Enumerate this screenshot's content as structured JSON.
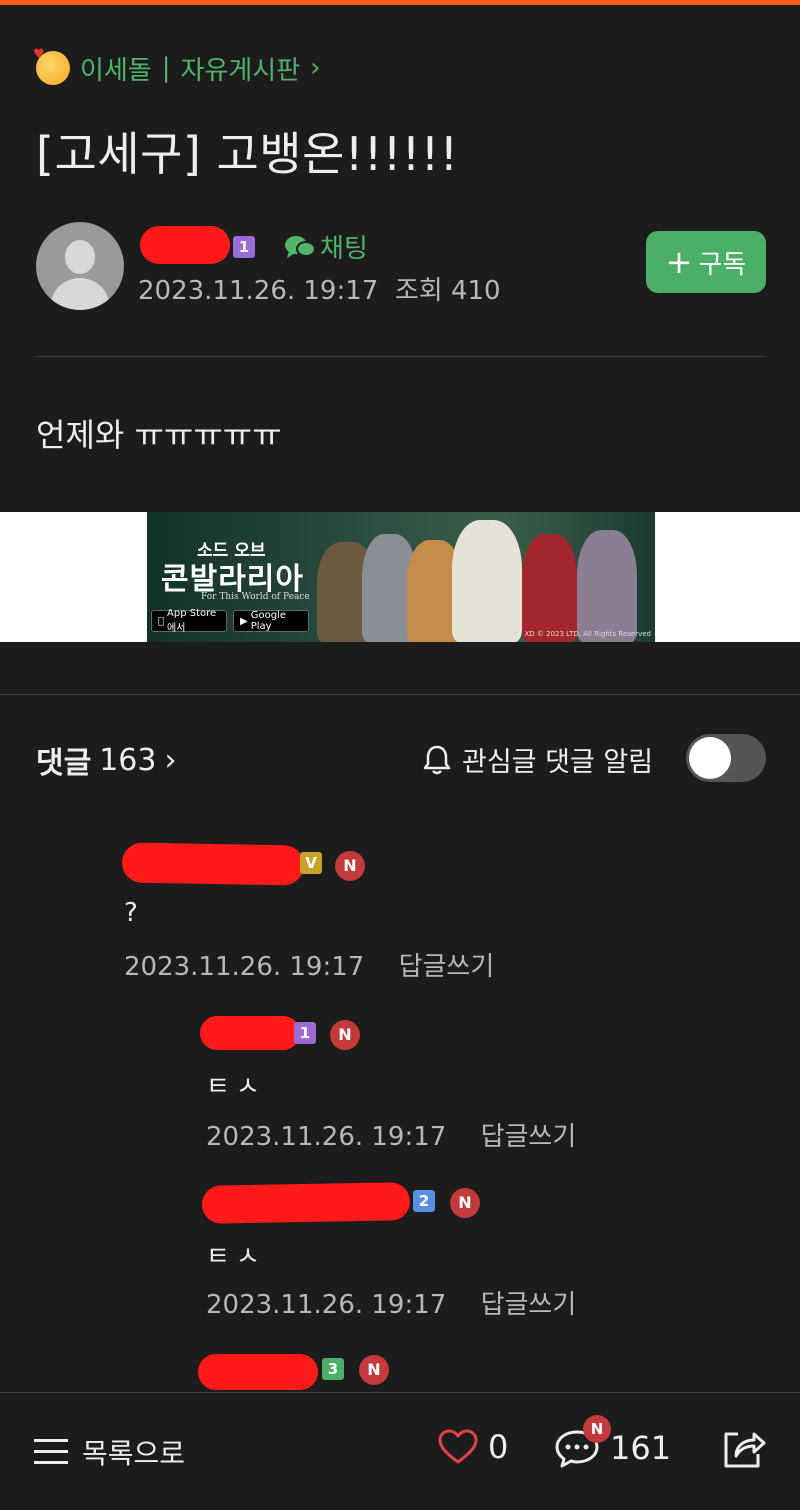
{
  "header": {
    "board_name": "이세돌",
    "board_sep": "|",
    "board_section": "자유게시판",
    "board_chevron": "›",
    "title": "[고세구] 고뱅온!!!!!!"
  },
  "author": {
    "level": "1",
    "chat_label": "채팅",
    "date": "2023.11.26. 19:17",
    "views_label": "조회",
    "views": "410",
    "subscribe_label": "구독",
    "subscribe_icon": "+"
  },
  "post": {
    "body": "언제와 ㅠㅠㅠㅠㅠ"
  },
  "ad": {
    "kicker": "소드 오브",
    "title": "콘발라리아",
    "tagline": "For This World of Peace",
    "store1": "App Store에서",
    "store2": "Google Play",
    "legal": "XD © 2023 LTD. All Rights Reserved"
  },
  "comments_section": {
    "label": "댓글",
    "count": "163",
    "chevron": "›",
    "notify_label": "관심글 댓글 알림",
    "notify_on": false
  },
  "comments": [
    {
      "level": "V",
      "new": "N",
      "text": "?",
      "date": "2023.11.26. 19:17",
      "reply_label": "답글쓰기"
    },
    {
      "level": "1",
      "new": "N",
      "text": "ㅌㅅ",
      "date": "2023.11.26. 19:17",
      "reply_label": "답글쓰기"
    },
    {
      "level": "2",
      "new": "N",
      "text": "ㅌㅅ",
      "date": "2023.11.26. 19:17",
      "reply_label": "답글쓰기"
    },
    {
      "level": "3",
      "new": "N"
    }
  ],
  "bottom_bar": {
    "list_label": "목록으로",
    "likes": "0",
    "comments": "161",
    "comment_badge": "N"
  },
  "colors": {
    "accent_green": "#4fb36a",
    "top_bar": "#ff5a1f",
    "background": "#1c1c1c",
    "new_badge": "#c23a3a",
    "redaction": "#ff1a1a"
  },
  "icons": [
    "emoji-smiling-hearts-icon",
    "chat-bubble-icon",
    "plus-icon",
    "bell-icon",
    "menu-icon",
    "heart-icon",
    "comment-icon",
    "share-icon",
    "chevron-right-icon"
  ]
}
